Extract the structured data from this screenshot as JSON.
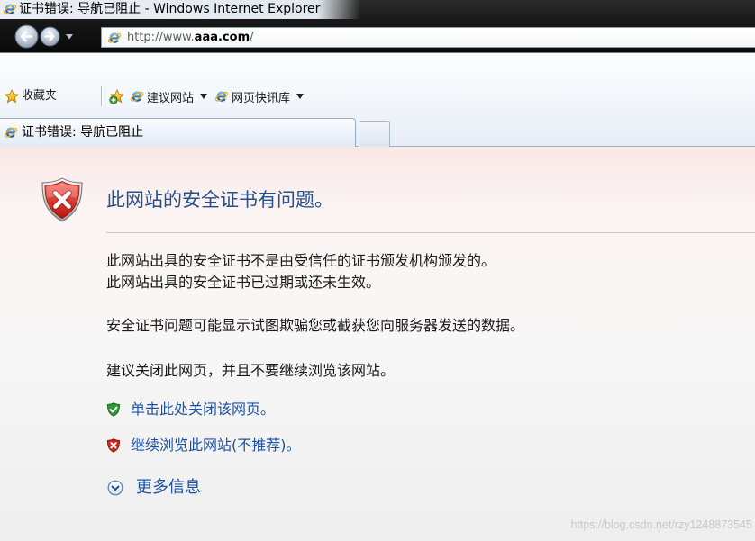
{
  "window": {
    "title": "证书错误: 导航已阻止 - Windows Internet Explorer"
  },
  "address_bar": {
    "url_prefix": "http://www.",
    "url_domain": "aaa.com",
    "url_suffix": "/"
  },
  "favorites_bar": {
    "favorites_label": "收藏夹",
    "items": [
      {
        "label": "建议网站"
      },
      {
        "label": "网页快讯库"
      }
    ]
  },
  "tabs": [
    {
      "label": "证书错误: 导航已阻止"
    }
  ],
  "page": {
    "heading": "此网站的安全证书有问题。",
    "issues": [
      "此网站出具的安全证书不是由受信任的证书颁发机构颁发的。",
      "此网站出具的安全证书已过期或还未生效。"
    ],
    "warning": "安全证书问题可能显示试图欺骗您或截获您向服务器发送的数据。",
    "recommendation": "建议关闭此网页，并且不要继续浏览该网站。",
    "close_link": "单击此处关闭该网页。",
    "continue_link": "继续浏览此网站(不推荐)。",
    "more_info": "更多信息"
  },
  "watermark": "https://blog.csdn.net/rzy1248873545",
  "icons": {
    "browser": "ie-icon",
    "back": "back-arrow-icon",
    "forward": "forward-arrow-icon",
    "history": "chevron-down-icon",
    "favorites": "favorites-star-icon",
    "add_favorite": "add-favorite-icon",
    "error": "error-shield-icon",
    "safe": "safe-shield-icon",
    "unsafe": "unsafe-shield-icon",
    "more_info": "expand-circle-icon"
  },
  "colors": {
    "heading": "#26508c",
    "link": "#1d52a3",
    "text": "#1a1a1a",
    "error": "#d3261c",
    "safe": "#2f9a33"
  }
}
